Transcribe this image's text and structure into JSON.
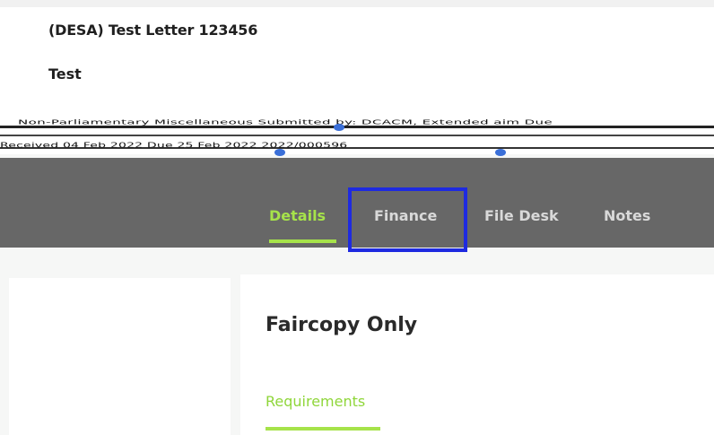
{
  "record": {
    "title": "(DESA) Test Letter 123456",
    "subtitle": "Test"
  },
  "meta": {
    "line_1": "Non-Parliamentary Miscellaneous   Submitted by: DCACM, Extended aim   Due",
    "line_2": "Received 04 Feb 2022   Due 25 Feb 2022   2022/000596"
  },
  "tabs": [
    {
      "label": "Details",
      "active": true
    },
    {
      "label": "Finance",
      "active": false
    },
    {
      "label": "File Desk",
      "active": false
    },
    {
      "label": "Notes",
      "active": false
    }
  ],
  "card": {
    "title": "Faircopy Only",
    "subtab": "Requirements"
  },
  "colors": {
    "accent": "#a6e34a",
    "tabbar_bg": "#676767",
    "highlight": "#1e2ae0"
  }
}
